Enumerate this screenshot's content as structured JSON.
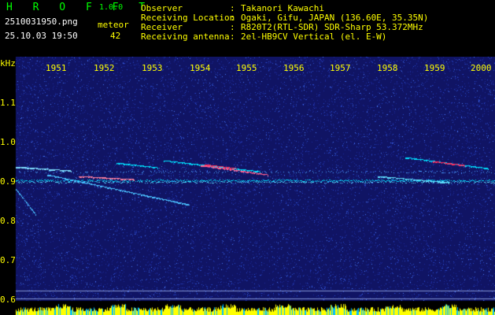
{
  "header": {
    "logo": "H R O F F T",
    "version": "1.0.0",
    "filename": "2510031950.png",
    "datetime": "25.10.03 19:50",
    "meteor_label": "meteor",
    "meteor_count": "42",
    "fields": [
      {
        "key": "Observer",
        "value": "Takanori Kawachi"
      },
      {
        "key": "Receiving Location",
        "value": "Ogaki, Gifu, JAPAN (136.60E, 35.35N)"
      },
      {
        "key": "Receiver",
        "value": "R820T2(RTL-SDR) SDR-Sharp 53.372MHz"
      },
      {
        "key": "Receiving antenna",
        "value": "2el-HB9CV Vertical (el. E-W)"
      }
    ]
  },
  "spectrogram": {
    "unit": "kHz",
    "time_ticks": [
      "1951",
      "1952",
      "1953",
      "1954",
      "1955",
      "1956",
      "1957",
      "1958",
      "1959",
      "2000"
    ],
    "freq_ticks": [
      "1.1",
      "1.0",
      "0.9",
      "0.8",
      "0.7",
      "0.6"
    ],
    "colors": {
      "background": "#101464",
      "noise": "#2a4ad0",
      "trace": "#00e0ff",
      "peak": "#ff3060",
      "power": "#ffff00",
      "power_low": "#00c0ff"
    }
  }
}
